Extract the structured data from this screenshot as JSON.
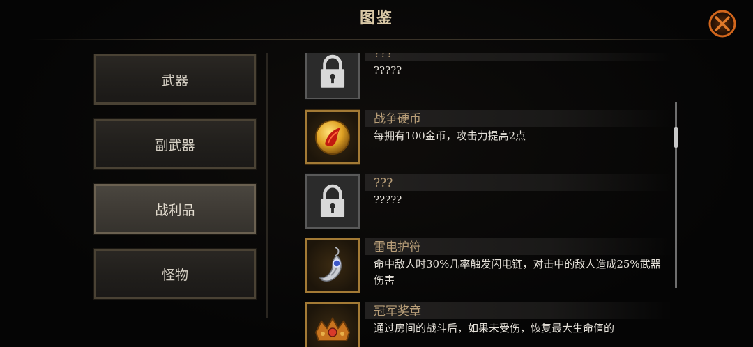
{
  "header": {
    "title": "图鉴",
    "close_icon": "close-x-icon",
    "accent_color": "#d2661c"
  },
  "categories": [
    {
      "label": "武器",
      "active": false
    },
    {
      "label": "副武器",
      "active": false
    },
    {
      "label": "战利品",
      "active": true
    },
    {
      "label": "怪物",
      "active": false
    }
  ],
  "entries": [
    {
      "name": "???",
      "desc": "?????",
      "icon": "padlock-icon",
      "locked": true
    },
    {
      "name": "战争硬币",
      "desc": "每拥有100金币，攻击力提高2点",
      "icon": "war-coin-icon",
      "locked": false
    },
    {
      "name": "???",
      "desc": "?????",
      "icon": "padlock-icon",
      "locked": true
    },
    {
      "name": "雷电护符",
      "desc": "命中敌人时30%几率触发闪电链，对击中的敌人造成25%武器伤害",
      "icon": "thunder-amulet-icon",
      "locked": false
    },
    {
      "name": "冠军奖章",
      "desc": "通过房间的战斗后，如果未受伤，恢复最大生命值的",
      "icon": "champion-medal-icon",
      "locked": false
    }
  ],
  "scroll": {
    "position": 0.15
  }
}
